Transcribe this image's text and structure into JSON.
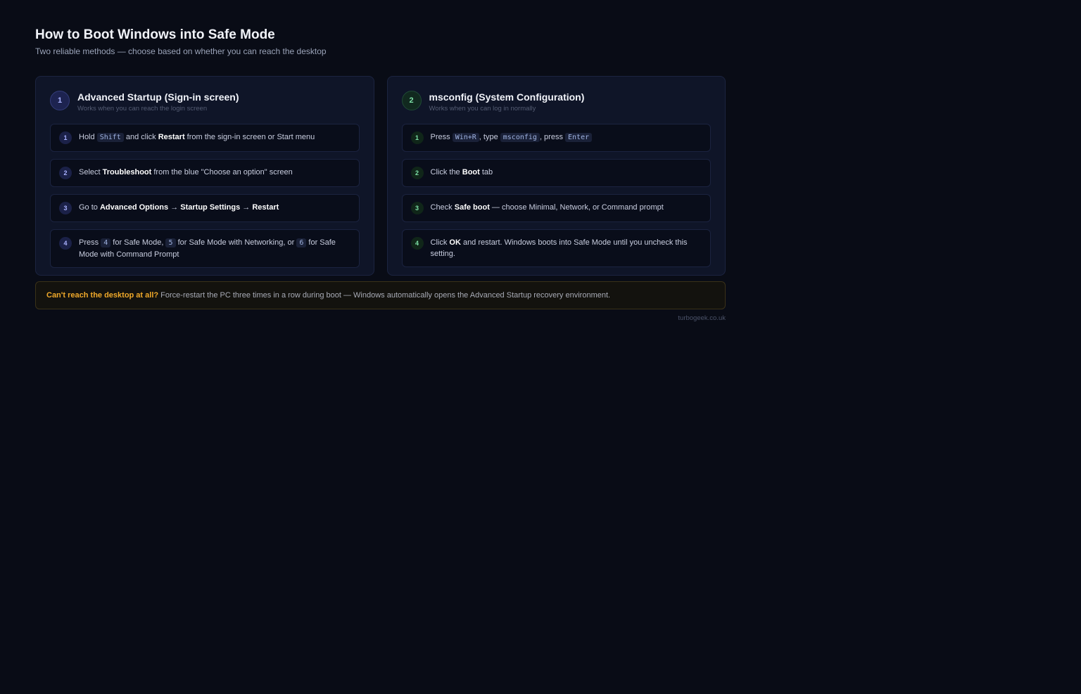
{
  "header": {
    "title": "How to Boot Windows into Safe Mode",
    "subtitle": "Two reliable methods — choose based on whether you can reach the desktop"
  },
  "methods": [
    {
      "number": "1",
      "title": "Advanced Startup (Sign-in screen)",
      "subtitle": "Works when you can reach the login screen",
      "accent": "#a9b2ff",
      "steps": [
        {
          "number": "1",
          "parts": [
            "Hold ",
            "Shift",
            " and click ",
            "Restart",
            " from the sign-in screen or Start menu"
          ]
        },
        {
          "number": "2",
          "parts": [
            "Select ",
            "Troubleshoot",
            " from the blue \"Choose an option\" screen"
          ]
        },
        {
          "number": "3",
          "parts": [
            "Go to ",
            "Advanced Options",
            " → ",
            "Startup Settings",
            " → ",
            "Restart"
          ]
        },
        {
          "number": "4",
          "parts": [
            "Press ",
            "4",
            " for Safe Mode, ",
            "5",
            " for Safe Mode with Networking, or ",
            "6",
            " for Safe Mode with Command Prompt"
          ]
        }
      ]
    },
    {
      "number": "2",
      "title": "msconfig (System Configuration)",
      "subtitle": "Works when you can log in normally",
      "accent": "#7ee2a8",
      "steps": [
        {
          "number": "1",
          "parts": [
            "Press ",
            "Win+R",
            ", type ",
            "msconfig",
            ", press ",
            "Enter"
          ]
        },
        {
          "number": "2",
          "parts": [
            "Click the ",
            "Boot",
            " tab"
          ]
        },
        {
          "number": "3",
          "parts": [
            "Check ",
            "Safe boot",
            " — choose Minimal, Network, or Command prompt"
          ]
        },
        {
          "number": "4",
          "parts": [
            "Click ",
            "OK",
            " and restart. Windows boots into Safe Mode until you uncheck this setting."
          ]
        }
      ]
    }
  ],
  "note": {
    "strong": "Can't reach the desktop at all?",
    "text": " Force-restart the PC three times in a row during boot — Windows automatically opens the Advanced Startup recovery environment."
  },
  "footer": {
    "source": "turbogeek.co.uk"
  },
  "colors": {
    "background": "#090c16",
    "method1_accent": "#a9b2ff",
    "method2_accent": "#7ee2a8",
    "warning": "#f0a92a"
  }
}
